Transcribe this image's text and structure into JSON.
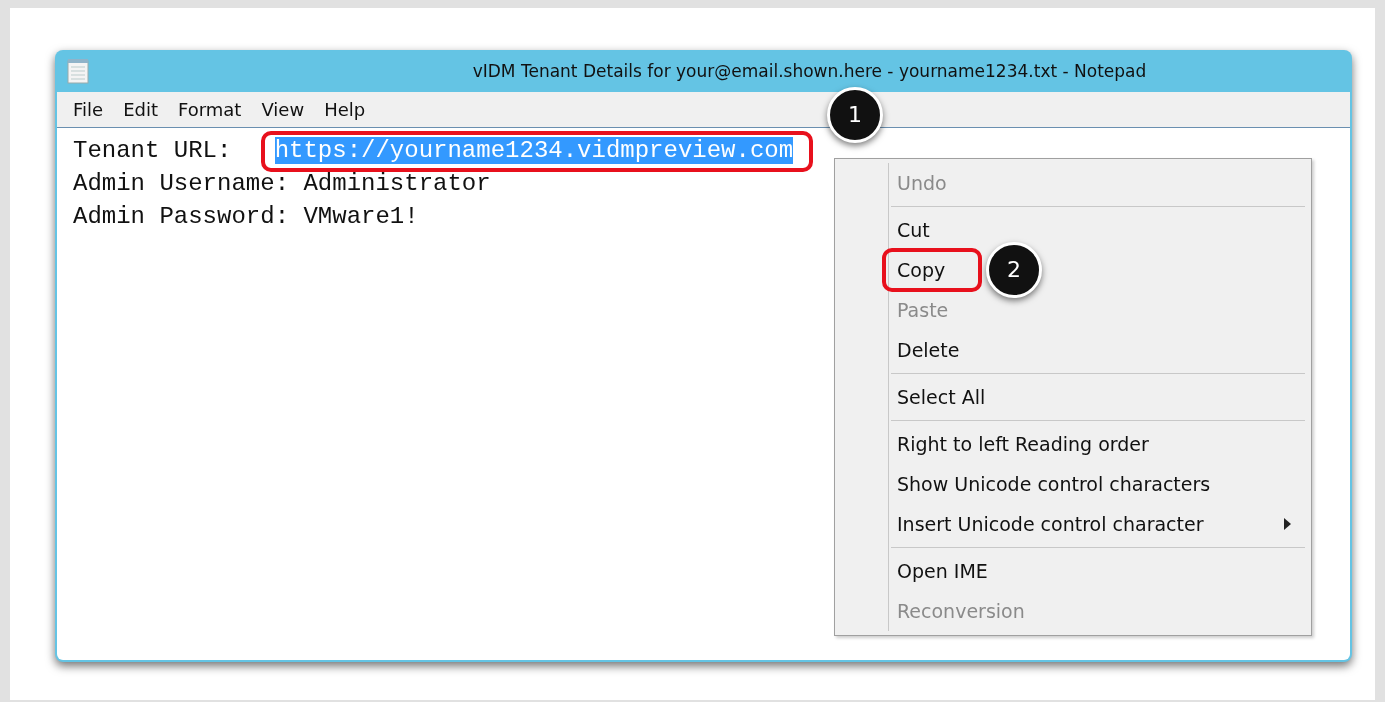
{
  "window": {
    "title": "vIDM Tenant Details for your@email.shown.here - yourname1234.txt - Notepad"
  },
  "menu_bar": [
    "File",
    "Edit",
    "Format",
    "View",
    "Help"
  ],
  "document": [
    {
      "label": "Tenant URL:   ",
      "value": "https://yourname1234.vidmpreview.com",
      "selected": true,
      "callout": "1"
    },
    {
      "label": "Admin Username: ",
      "value": "Administrator",
      "selected": false
    },
    {
      "label": "Admin Password: ",
      "value": "VMware1!",
      "selected": false
    }
  ],
  "context_menu": [
    {
      "kind": "item",
      "label": "Undo",
      "disabled": true
    },
    {
      "kind": "separator"
    },
    {
      "kind": "item",
      "label": "Cut",
      "disabled": false
    },
    {
      "kind": "item",
      "label": "Copy",
      "disabled": false,
      "callout": "2"
    },
    {
      "kind": "item",
      "label": "Paste",
      "disabled": true
    },
    {
      "kind": "item",
      "label": "Delete",
      "disabled": false
    },
    {
      "kind": "separator"
    },
    {
      "kind": "item",
      "label": "Select All",
      "disabled": false
    },
    {
      "kind": "separator"
    },
    {
      "kind": "item",
      "label": "Right to left Reading order",
      "disabled": false
    },
    {
      "kind": "item",
      "label": "Show Unicode control characters",
      "disabled": false
    },
    {
      "kind": "item",
      "label": "Insert Unicode control character",
      "disabled": false,
      "submenu": true
    },
    {
      "kind": "separator"
    },
    {
      "kind": "item",
      "label": "Open IME",
      "disabled": false
    },
    {
      "kind": "item",
      "label": "Reconversion",
      "disabled": true
    }
  ]
}
